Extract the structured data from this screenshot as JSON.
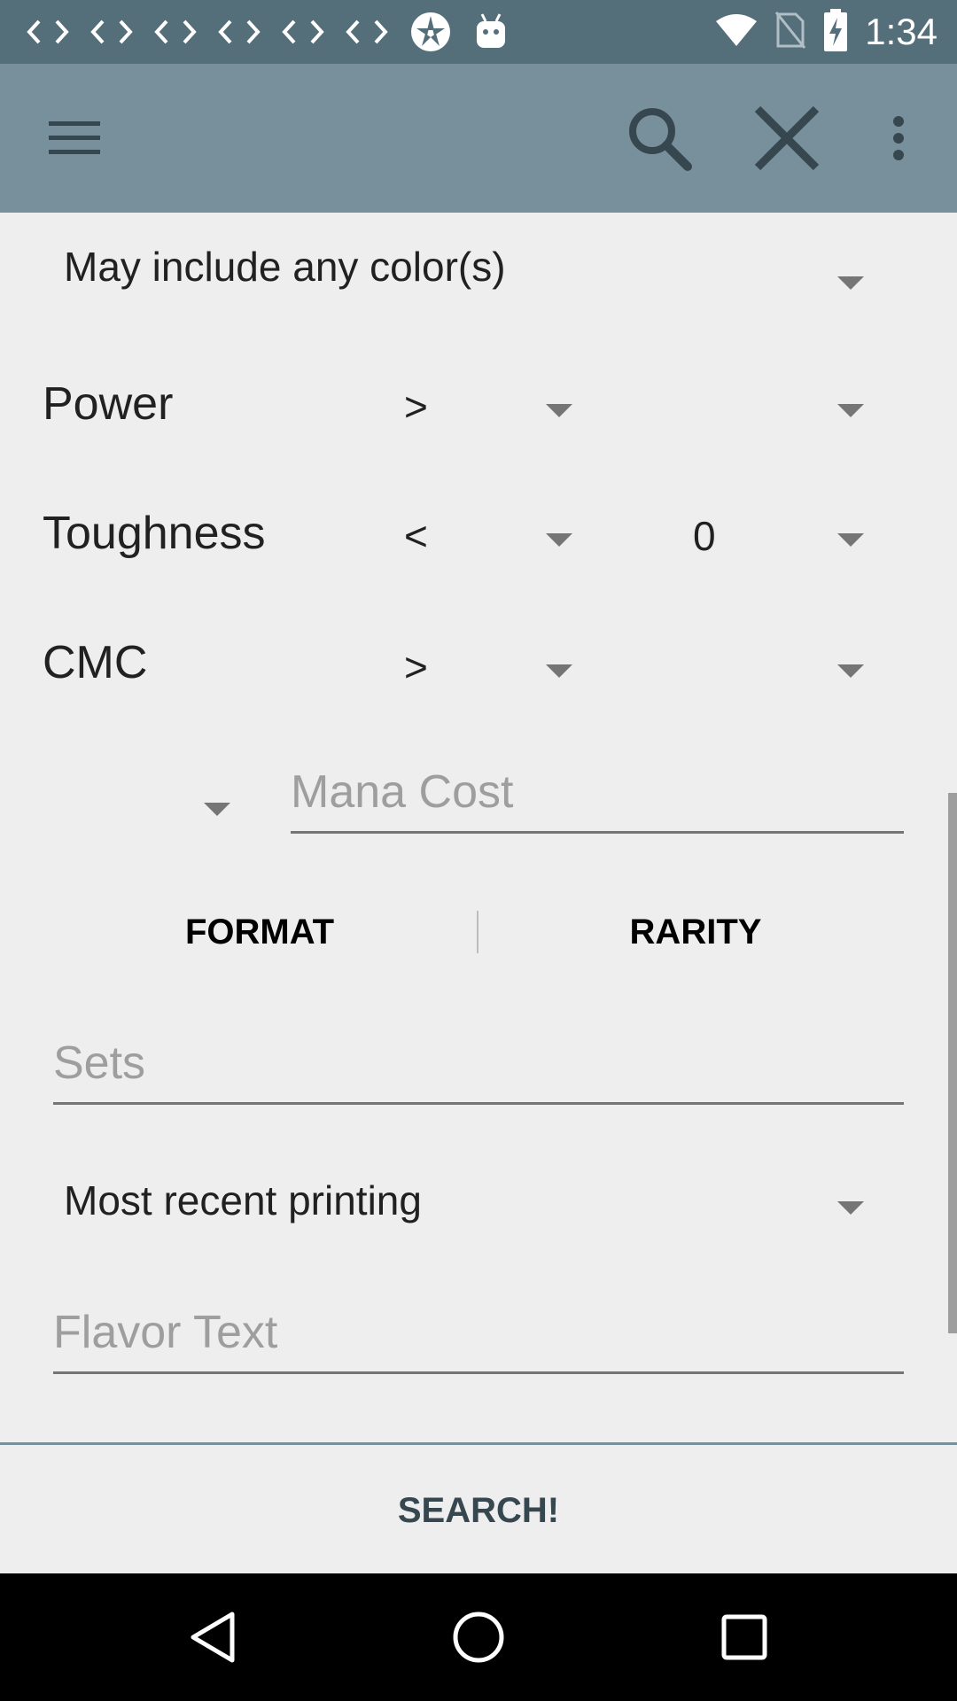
{
  "status_bar": {
    "time": "1:34",
    "left_icons": [
      "code-icon",
      "code-icon",
      "code-icon",
      "code-icon",
      "code-icon",
      "code-icon",
      "aperture-icon",
      "android-icon"
    ],
    "right_icons": [
      "wifi-icon",
      "no-sim-icon",
      "battery-charging-icon"
    ]
  },
  "toolbar": {
    "menu_icon": "hamburger-menu-icon",
    "search_icon": "search-icon",
    "close_icon": "close-icon",
    "overflow_icon": "more-vertical-icon",
    "background": "#78909c"
  },
  "form": {
    "color_mode": "May include any color(s)",
    "power": {
      "label": "Power",
      "comparator": ">",
      "value": ""
    },
    "toughness": {
      "label": "Toughness",
      "comparator": "<",
      "value": "0"
    },
    "cmc": {
      "label": "CMC",
      "comparator": ">",
      "value": ""
    },
    "mana_cost_placeholder": "Mana Cost",
    "format_button": "FORMAT",
    "rarity_button": "RARITY",
    "sets_placeholder": "Sets",
    "printing_mode": "Most recent printing",
    "flavor_placeholder": "Flavor Text"
  },
  "search_button": "SEARCH!",
  "nav_bar": {
    "back_icon": "back-icon",
    "home_icon": "home-icon",
    "recents_icon": "recents-icon"
  }
}
